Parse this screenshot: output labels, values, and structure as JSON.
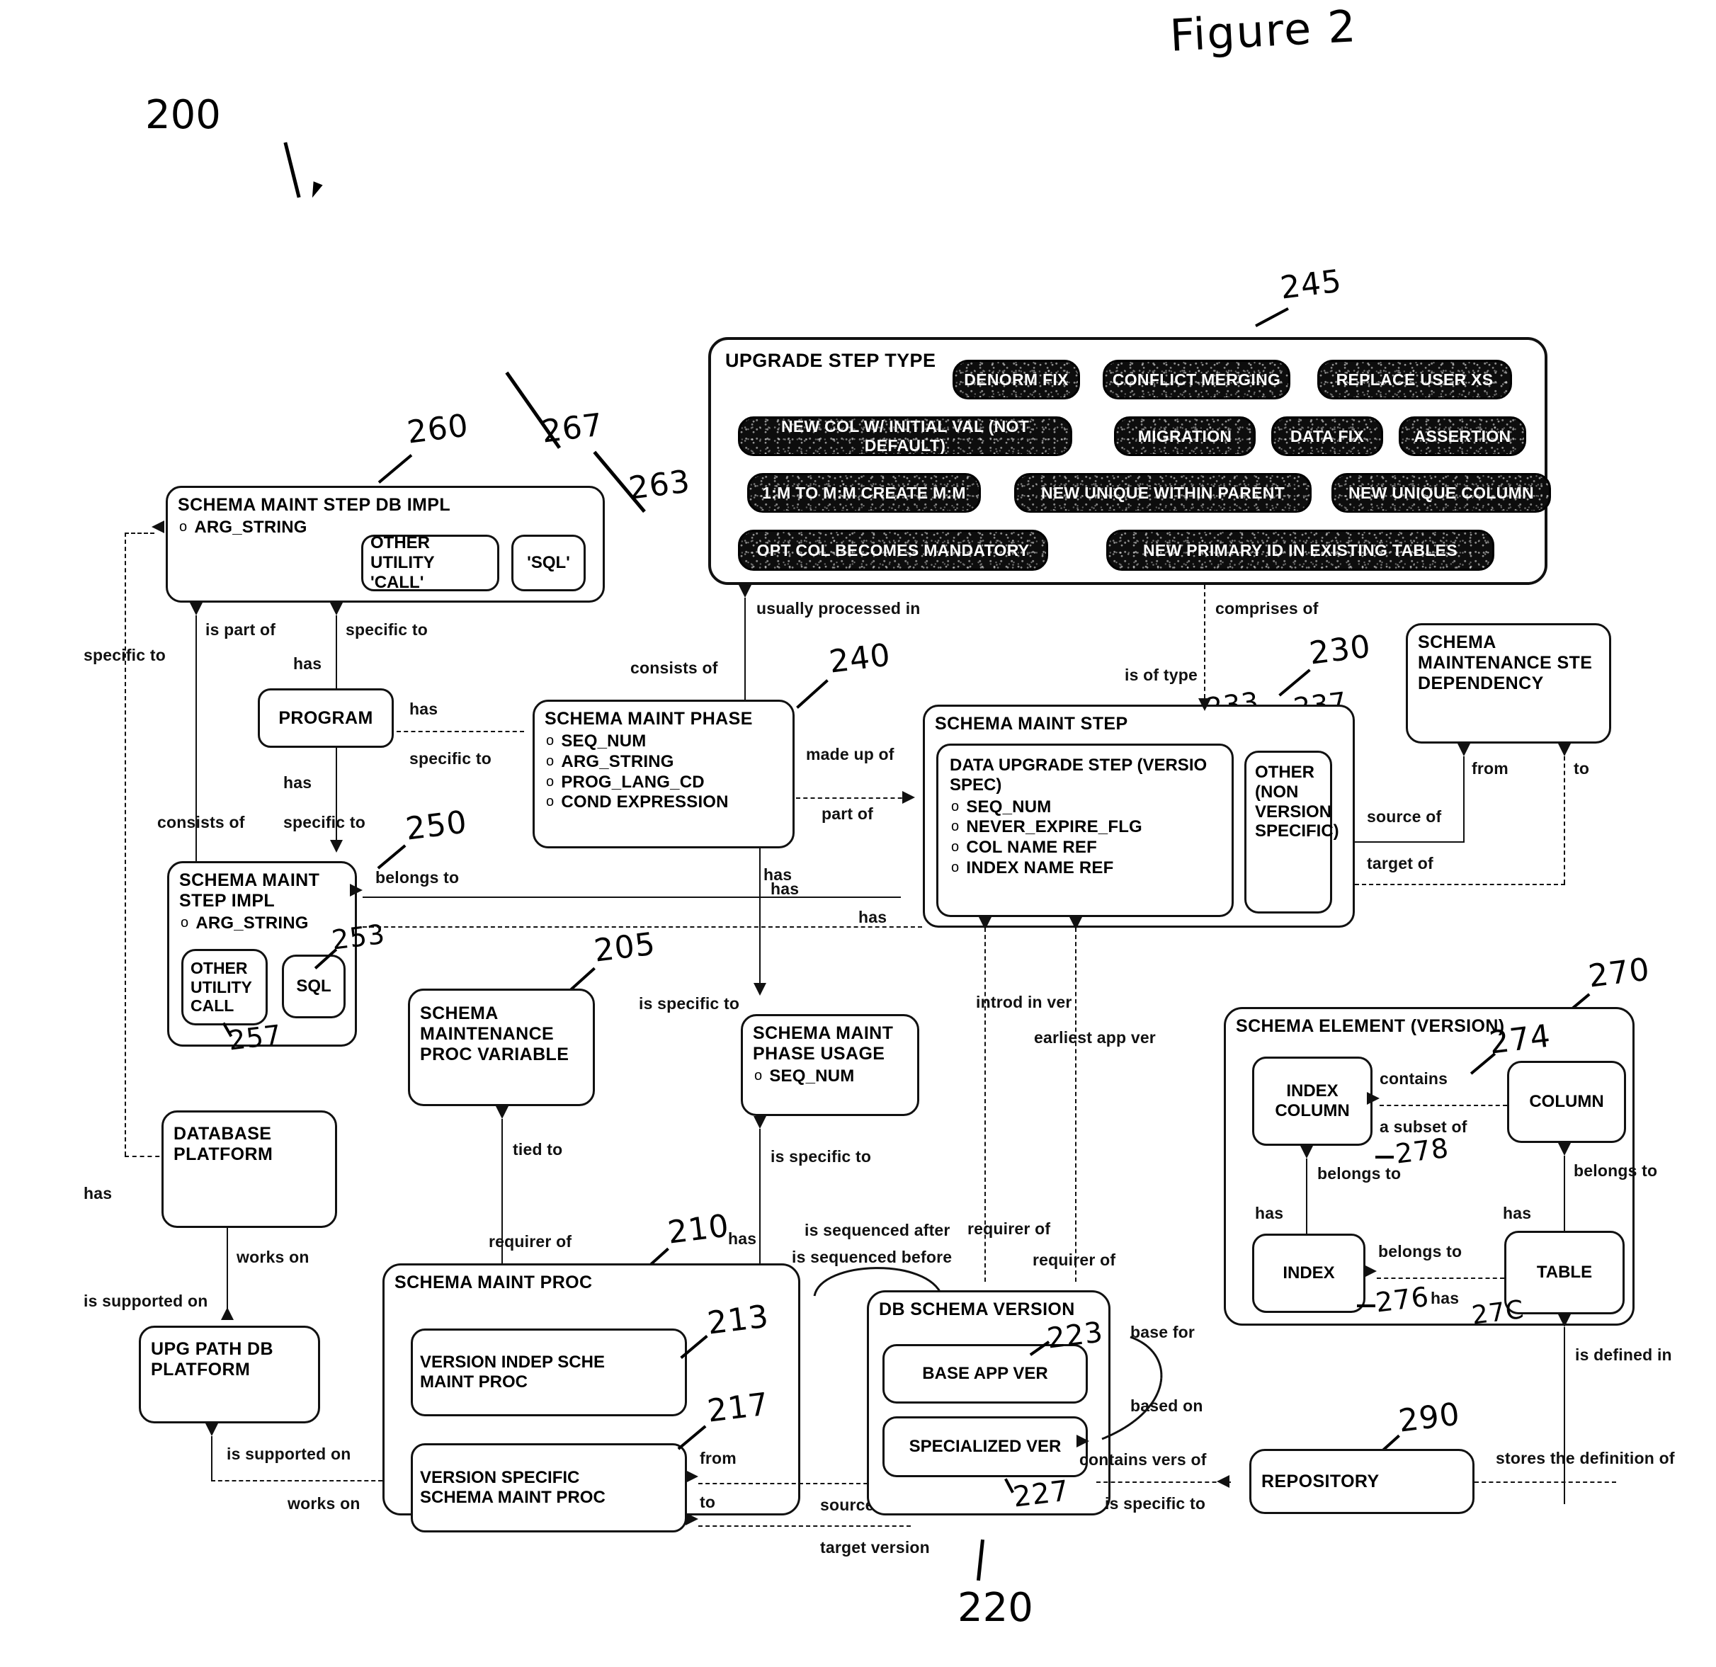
{
  "figure": {
    "title": "Figure 2",
    "diagram_ref": "200"
  },
  "refs": {
    "r200": "200",
    "r205": "205",
    "r210": "210",
    "r213": "213",
    "r217": "217",
    "r220": "220",
    "r223": "223",
    "r227": "227",
    "r230": "230",
    "r233": "233",
    "r237": "237",
    "r240": "240",
    "r245": "245",
    "r250": "250",
    "r253": "253",
    "r257": "257",
    "r260": "260",
    "r263": "263",
    "r267": "267",
    "r270": "270",
    "r274": "274",
    "r276": "276",
    "r278": "278",
    "r279": "27C",
    "r290": "290"
  },
  "entities": {
    "upgrade_step_type": {
      "title": "UPGRADE STEP TYPE",
      "types": [
        "DENORM FIX",
        "CONFLICT MERGING",
        "REPLACE USER XS",
        "NEW COL W/ INITIAL VAL (NOT DEFAULT)",
        "MIGRATION",
        "DATA FIX",
        "ASSERTION",
        "1:M TO M:M CREATE M:M",
        "NEW UNIQUE WITHIN PARENT",
        "NEW UNIQUE COLUMN",
        "OPT COL BECOMES MANDATORY",
        "NEW PRIMARY ID IN EXISTING TABLES"
      ]
    },
    "schema_maint_step_db_impl": {
      "title": "SCHEMA MAINT STEP DB IMPL",
      "attrs": [
        "ARG_STRING"
      ],
      "sub_other_utility_call": "OTHER UTILITY\n'CALL'",
      "sub_sql": "'SQL'"
    },
    "program": {
      "title": "PROGRAM"
    },
    "schema_maint_phase": {
      "title": "SCHEMA MAINT PHASE",
      "attrs": [
        "SEQ_NUM",
        "ARG_STRING",
        "PROG_LANG_CD",
        "COND EXPRESSION"
      ]
    },
    "schema_maint_step": {
      "title": "SCHEMA MAINT STEP",
      "data_upgrade_step": {
        "title": "DATA UPGRADE STEP (VERSIO\nSPEC)",
        "attrs": [
          "SEQ_NUM",
          "NEVER_EXPIRE_FLG",
          "COL NAME REF",
          "INDEX NAME REF"
        ]
      },
      "other_non_version_specific": "OTHER\n(NON\nVERSION\nSPECIFIC)"
    },
    "schema_maintenance_step_dependency": {
      "title": "SCHEMA\nMAINTENANCE STE\nDEPENDENCY"
    },
    "schema_maint_step_impl": {
      "title": "SCHEMA MAINT\nSTEP IMPL",
      "attrs": [
        "ARG_STRING"
      ],
      "sub_other_utility_call": "OTHER\nUTILITY\nCALL",
      "sub_sql": "SQL"
    },
    "schema_maintenance_proc_variable": {
      "title": "SCHEMA\nMAINTENANCE\nPROC VARIABLE"
    },
    "schema_maint_phase_usage": {
      "title": "SCHEMA MAINT\nPHASE USAGE",
      "attrs": [
        "SEQ_NUM"
      ]
    },
    "database_platform": {
      "title": "DATABASE\nPLATFORM"
    },
    "upg_path_db_platform": {
      "title": "UPG PATH DB\nPLATFORM"
    },
    "schema_maint_proc": {
      "title": "SCHEMA MAINT PROC",
      "version_indep": "VERSION INDEP SCHE\nMAINT PROC",
      "version_specific": "VERSION SPECIFIC\nSCHEMA MAINT PROC"
    },
    "db_schema_version": {
      "title": "DB SCHEMA VERSION",
      "base_app_ver": "BASE APP VER",
      "specialized_ver": "SPECIALIZED VER"
    },
    "schema_element_version": {
      "title": "SCHEMA ELEMENT (VERSION)",
      "index_column": "INDEX\nCOLUMN",
      "column": "COLUMN",
      "index": "INDEX",
      "table": "TABLE"
    },
    "repository": {
      "title": "REPOSITORY"
    }
  },
  "relationships": {
    "is_part_of": "is part of",
    "specific_to_1": "specific to",
    "specific_to_2": "specific to",
    "has_1": "has",
    "usually_processed_in": "usually processed in",
    "comprises_of": "comprises of",
    "consists_of_1": "consists of",
    "is_of_type": "is of type",
    "has_program": "has",
    "specific_to_3": "specific to",
    "has_2": "has",
    "made_up_of": "made up of",
    "part_of": "part of",
    "from_1": "from",
    "to_1": "to",
    "source_of": "source of",
    "target_of": "target of",
    "consists_of_2": "consists of",
    "specific_to_4": "specific to",
    "has_3": "has",
    "belongs_to_1": "belongs to",
    "has_4": "has",
    "has_5": "has",
    "is_specific_to_1": "is specific to",
    "introd_in_ver": "introd in ver",
    "earliest_app_ver": "earliest app ver",
    "contains": "contains",
    "a_subset_of": "a subset of",
    "belongs_to_2": "belongs to",
    "belongs_to_3": "belongs to",
    "has_6": "has",
    "has_7": "has",
    "belongs_to_4": "belongs to",
    "has_8": "has",
    "tied_to": "tied to",
    "is_specific_to_2": "is specific to",
    "has_9": "has",
    "requirer_of_1": "requirer of",
    "is_sequenced_after": "is sequenced after",
    "is_sequenced_before": "is sequenced before",
    "requirer_of_2": "requirer of",
    "requirer_of_3": "requirer of",
    "has_10": "has",
    "works_on_1": "works on",
    "is_supported_on_1": "is supported on",
    "is_supported_on_2": "is supported on",
    "works_on_2": "works on",
    "from_2": "from",
    "to_2": "to",
    "source_version": "source version",
    "target_version": "target version",
    "base_for": "base for",
    "based_on": "based on",
    "contains_vers_of": "contains vers of",
    "is_specific_to_3": "is specific to",
    "stores_the_definition_of": "stores the definition of",
    "is_defined_in": "is defined in"
  }
}
